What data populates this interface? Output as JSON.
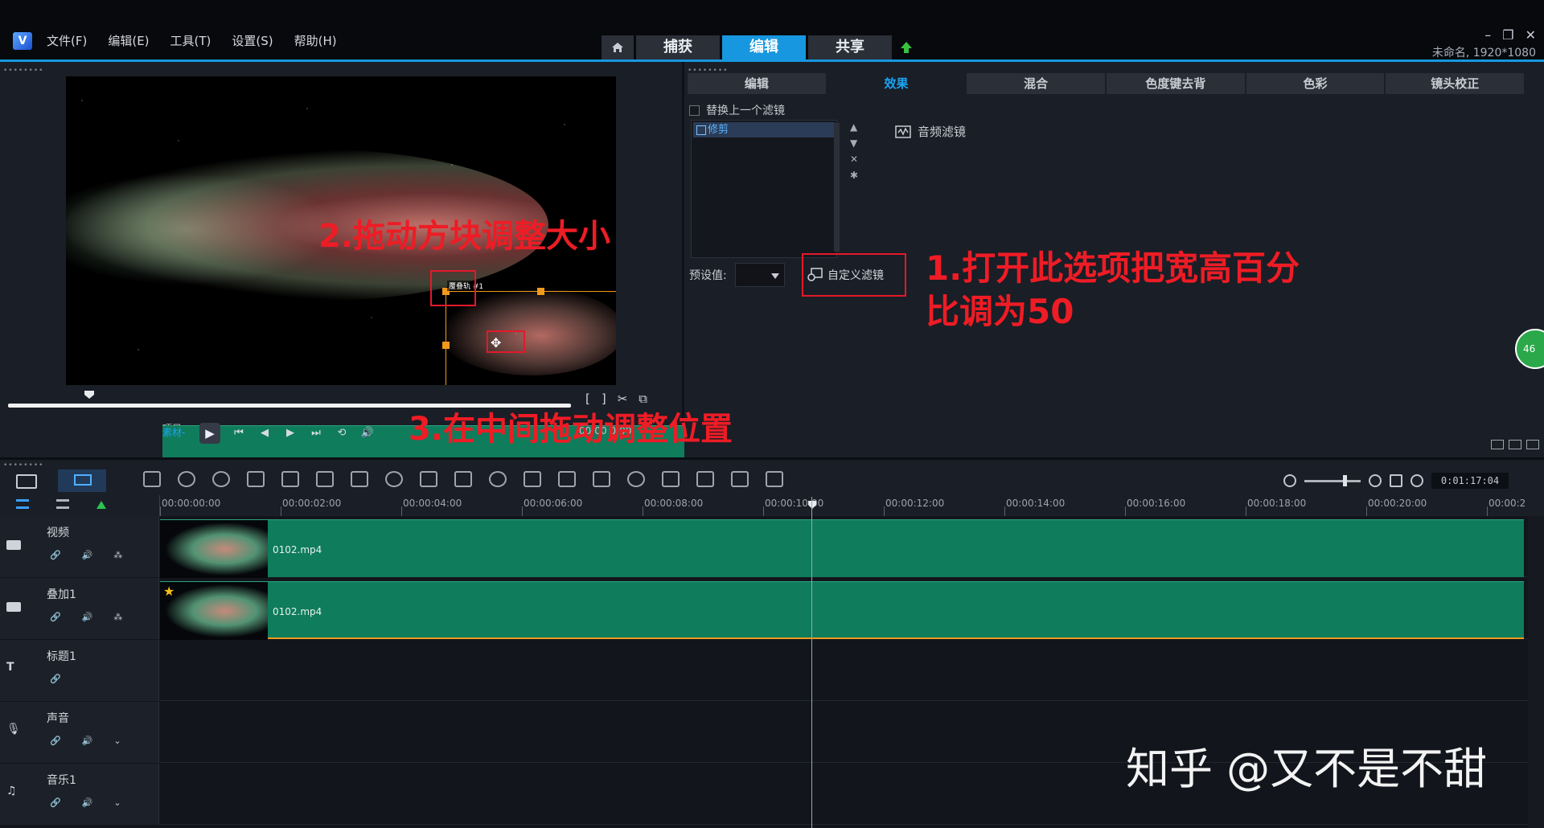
{
  "menu": [
    "文件(F)",
    "编辑(E)",
    "工具(T)",
    "设置(S)",
    "帮助(H)"
  ],
  "mode_tabs": [
    "捕获",
    "编辑",
    "共享"
  ],
  "project_info": "未命名, 1920*1080",
  "player": {
    "overlay_label": "覆叠轨 #1",
    "project_label": "项目-",
    "clip_label": "素材-",
    "timecode": "00:00 0:00"
  },
  "options": {
    "tabs": [
      "编辑",
      "效果",
      "混合",
      "色度键去背",
      "色彩",
      "镜头校正"
    ],
    "replace_filter": "替换上一个滤镜",
    "filter_item": "修剪",
    "audio_filter": "音频滤镜",
    "preset_label": "预设值:",
    "custom_filter": "自定义滤镜",
    "badge": "46"
  },
  "annotations": {
    "a1_line1": "1.打开此选项把宽高百分",
    "a1_line2": "比调为50",
    "a2": "2.拖动方块调整大小",
    "a3": "3.在中间拖动调整位置"
  },
  "timeline": {
    "timecode": "0:01:17:04",
    "ruler": [
      "00:00:00:00",
      "00:00:02:00",
      "00:00:04:00",
      "00:00:06:00",
      "00:00:08:00",
      "00:00:10:00",
      "00:00:12:00",
      "00:00:14:00",
      "00:00:16:00",
      "00:00:18:00",
      "00:00:20:00",
      "00:00:2"
    ],
    "tracks": [
      {
        "name": "视频",
        "clip": "0102.mp4"
      },
      {
        "name": "叠加1",
        "clip": "0102.mp4"
      },
      {
        "name": "标题1",
        "clip": ""
      },
      {
        "name": "声音",
        "clip": ""
      },
      {
        "name": "音乐1",
        "clip": ""
      }
    ]
  },
  "watermark": "知乎 @又不是不甜",
  "colors": {
    "accent": "#1797df",
    "clip": "#0f7c5b",
    "annotation": "#ee1c25",
    "overlay_frame": "#f29a1a"
  }
}
